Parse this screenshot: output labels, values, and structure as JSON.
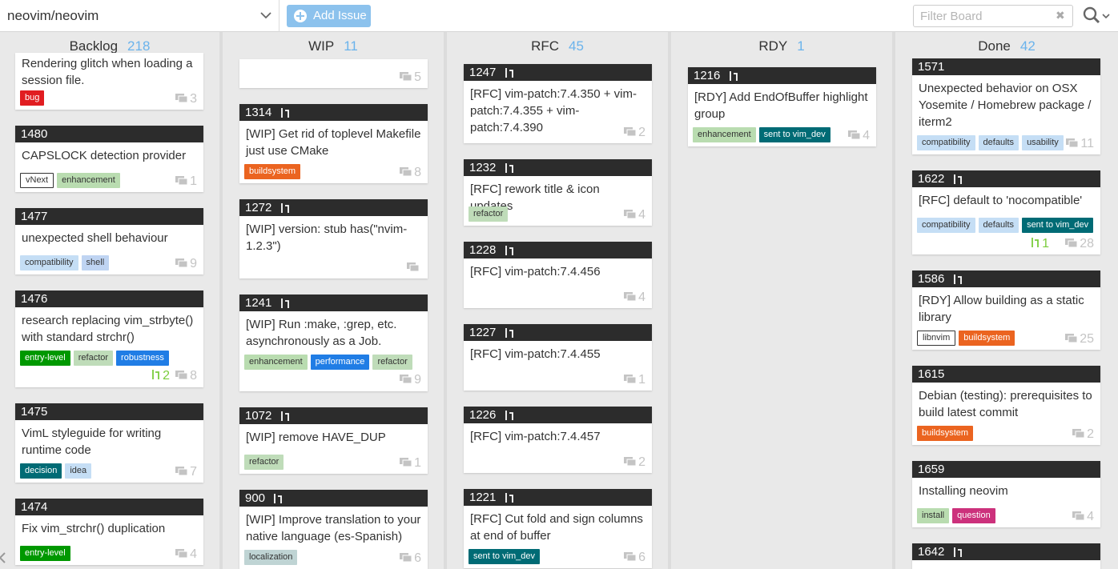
{
  "header": {
    "repo": "neovim/neovim",
    "add_issue": "Add Issue",
    "filter_placeholder": "Filter Board"
  },
  "colors": {
    "accent": "#6ab3ec",
    "add_button": "#8cc2ed",
    "card_header": "#2c2c2c"
  },
  "columns": [
    {
      "title": "Backlog",
      "count": "218"
    },
    {
      "title": "WIP",
      "count": "11"
    },
    {
      "title": "RFC",
      "count": "45"
    },
    {
      "title": "RDY",
      "count": "1"
    },
    {
      "title": "Done",
      "count": "42"
    }
  ],
  "backlog": [
    {
      "title": "Rendering glitch when loading a session file.",
      "labels": [
        "bug"
      ],
      "comments": "3"
    },
    {
      "number": "1480",
      "title": "CAPSLOCK detection provider",
      "labels": [
        "vNext",
        "enhancement"
      ],
      "comments": "1"
    },
    {
      "number": "1477",
      "title": "unexpected shell behaviour",
      "labels": [
        "compatibility",
        "shell"
      ],
      "comments": "9"
    },
    {
      "number": "1476",
      "title": "research replacing vim_strbyte() with standard strchr()",
      "labels": [
        "entry-level",
        "refactor",
        "robustness"
      ],
      "prs": "2",
      "comments": "8"
    },
    {
      "number": "1475",
      "title": "VimL styleguide for writing runtime code",
      "labels": [
        "decision",
        "idea"
      ],
      "comments": "7"
    },
    {
      "number": "1474",
      "title": "Fix vim_strchr() duplication",
      "labels": [
        "entry-level"
      ],
      "comments": "4"
    }
  ],
  "wip": [
    {
      "comments": "5"
    },
    {
      "number": "1314",
      "title": "[WIP] Get rid of toplevel Makefile just use CMake",
      "labels": [
        "buildsystem"
      ],
      "comments": "8"
    },
    {
      "number": "1272",
      "title": "[WIP] version: stub has(\"nvim-1.2.3\")",
      "labels": [],
      "comments": ""
    },
    {
      "number": "1241",
      "title": "[WIP] Run :make, :grep, etc. asynchronously as a Job.",
      "labels": [
        "enhancement",
        "performance",
        "refactor"
      ],
      "comments": "9"
    },
    {
      "number": "1072",
      "title": "[WIP] remove HAVE_DUP",
      "labels": [
        "refactor"
      ],
      "comments": "1"
    },
    {
      "number": "900",
      "title": "[WIP] Improve translation to your native language (es-Spanish)",
      "labels": [
        "localization"
      ],
      "comments": "6"
    }
  ],
  "rfc": [
    {
      "number": "1247",
      "title": "[RFC] vim-patch:7.4.350 + vim-patch:7.4.355 + vim-patch:7.4.390",
      "labels": [],
      "comments": "2"
    },
    {
      "number": "1232",
      "title": "[RFC] rework title & icon updates",
      "labels": [
        "refactor"
      ],
      "comments": "4"
    },
    {
      "number": "1228",
      "title": "[RFC] vim-patch:7.4.456",
      "labels": [],
      "comments": "4"
    },
    {
      "number": "1227",
      "title": "[RFC] vim-patch:7.4.455",
      "labels": [],
      "comments": "1"
    },
    {
      "number": "1226",
      "title": "[RFC] vim-patch:7.4.457",
      "labels": [],
      "comments": "2"
    },
    {
      "number": "1221",
      "title": "[RFC] Cut fold and sign columns at end of buffer",
      "labels": [
        "sent to vim_dev"
      ],
      "comments": "6"
    }
  ],
  "rdy": [
    {
      "number": "1216",
      "title": "[RDY] Add EndOfBuffer highlight group",
      "labels": [
        "enhancement",
        "sent to vim_dev"
      ],
      "comments": "4"
    }
  ],
  "done": [
    {
      "number": "1571",
      "title": "Unexpected behavior on OSX Yosemite / Homebrew package / iterm2",
      "labels": [
        "compatibility",
        "defaults",
        "usability"
      ],
      "comments": "11"
    },
    {
      "number": "1622",
      "title": "[RFC] default to 'nocompatible'",
      "labels": [
        "compatibility",
        "defaults",
        "sent to vim_dev"
      ],
      "prs": "1",
      "comments": "28"
    },
    {
      "number": "1586",
      "title": "[RDY] Allow building as a static library",
      "labels": [
        "libnvim",
        "buildsystem"
      ],
      "comments": "25"
    },
    {
      "number": "1615",
      "title": "Debian (testing): prerequisites to build latest commit",
      "labels": [
        "buildsystem"
      ],
      "comments": "2"
    },
    {
      "number": "1659",
      "title": "Installing neovim",
      "labels": [
        "install",
        "question"
      ],
      "comments": "4"
    },
    {
      "number": "1642"
    }
  ]
}
